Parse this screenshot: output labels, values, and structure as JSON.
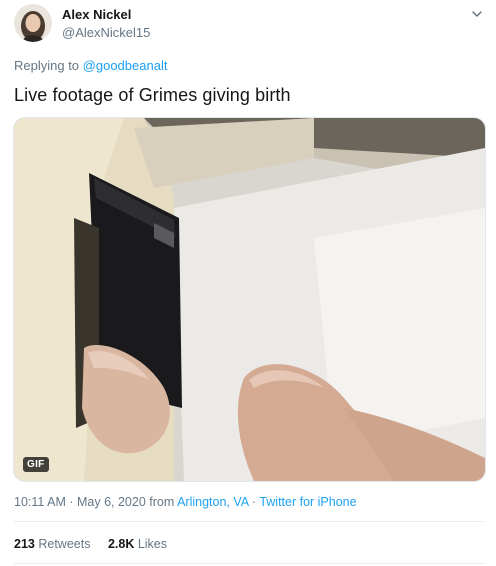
{
  "author": {
    "name": "Alex Nickel",
    "handle": "@AlexNickel15"
  },
  "reply": {
    "prefix": "Replying to",
    "mention": "@goodbeanalt"
  },
  "tweet": {
    "text": "Live footage of Grimes giving birth"
  },
  "media": {
    "badge": "GIF"
  },
  "meta": {
    "time_date": "10:11 AM · May 6, 2020 from",
    "location": "Arlington, VA",
    "separator": "·",
    "source": "Twitter for iPhone"
  },
  "stats": {
    "retweets_count": "213",
    "retweets_label": "Retweets",
    "likes_count": "2.8K",
    "likes_label": "Likes"
  },
  "icons": [
    "avatar",
    "chevron-down-icon"
  ],
  "colors": {
    "link": "#1da1f2",
    "secondary_text": "#657786",
    "primary_text": "#14171a"
  }
}
